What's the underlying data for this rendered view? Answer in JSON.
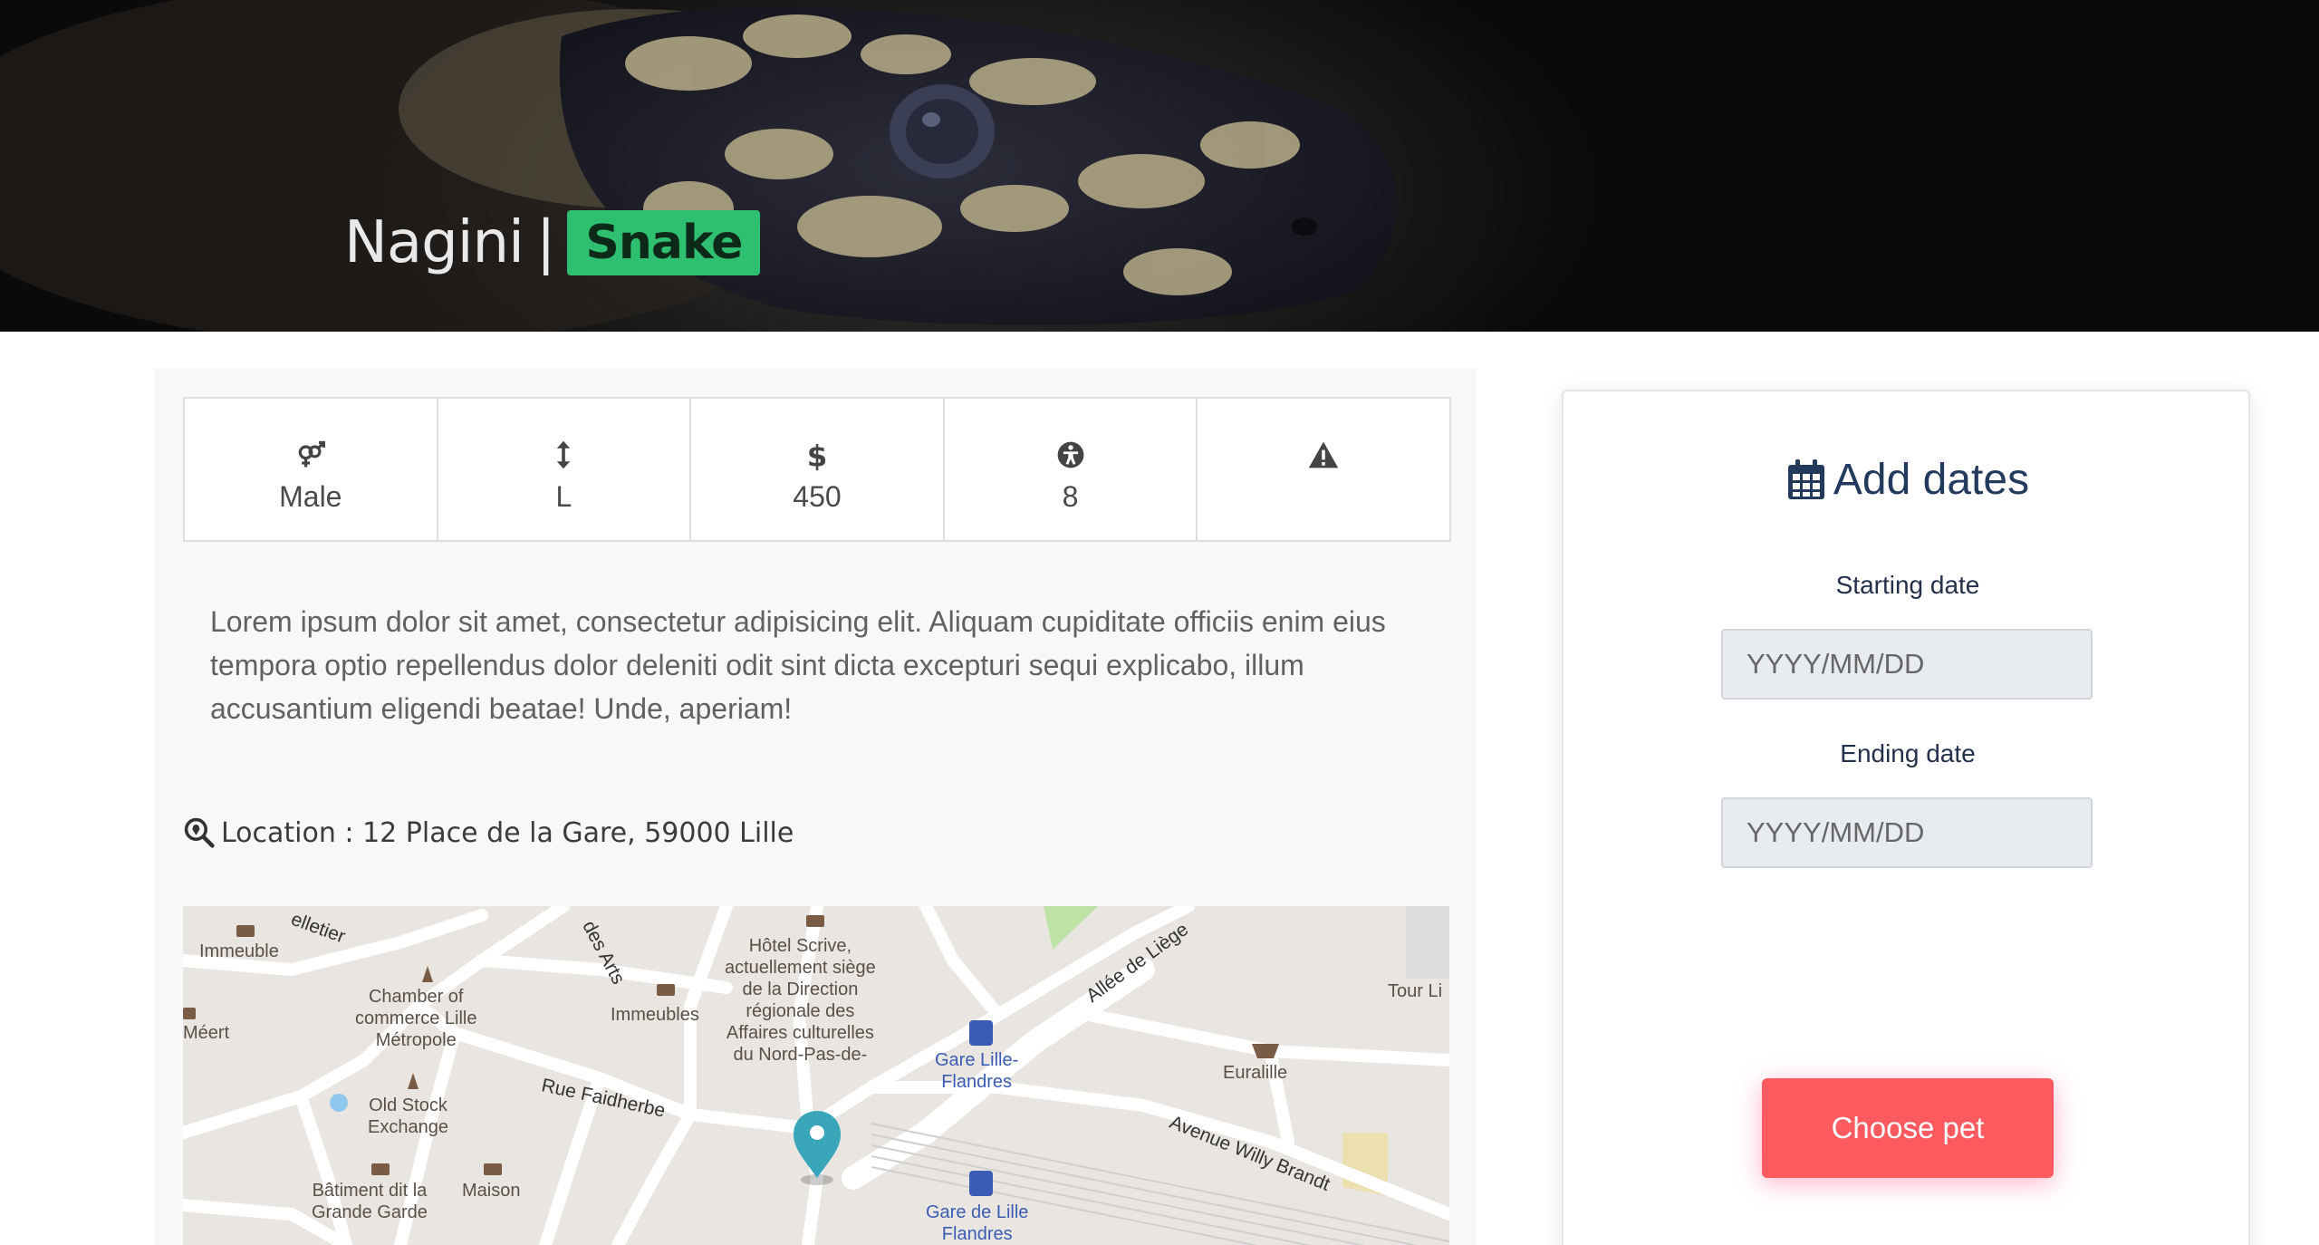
{
  "hero": {
    "pet_name": "Nagini",
    "separator": "|",
    "species": "Snake"
  },
  "stats": [
    {
      "icon": "gender-icon",
      "value": "Male"
    },
    {
      "icon": "size-arrows-icon",
      "value": "L"
    },
    {
      "icon": "dollar-icon",
      "value": "450"
    },
    {
      "icon": "accessibility-icon",
      "value": "8"
    },
    {
      "icon": "warning-icon",
      "value": ""
    }
  ],
  "description": "Lorem ipsum dolor sit amet, consectetur adipisicing elit. Aliquam cupiditate officiis enim eius tempora optio repellendus dolor deleniti odit sint dicta excepturi sequi explicabo, illum accusantium eligendi beatae! Unde, aperiam!",
  "location": {
    "icon": "search-location-icon",
    "text": "Location : 12 Place de la Gare, 59000 Lille"
  },
  "map": {
    "labels": {
      "immeuble": "Immeuble",
      "meert": "Méert",
      "chamber": "Chamber of\ncommerce Lille\nMétropole",
      "old_stock": "Old Stock\nExchange",
      "batiment": "Bâtiment dit la\nGrande Garde",
      "maison": "Maison",
      "immeubles": "Immeubles",
      "hotel_scrive": "Hôtel Scrive,\nactuellement siège\nde la Direction\nrégionale des\nAffaires culturelles\ndu Nord-Pas-de-",
      "gare_flandres_1": "Gare Lille-\nFlandres",
      "gare_flandres_2": "Gare de Lille\nFlandres",
      "euralille": "Euralille",
      "tour_li": "Tour Li"
    },
    "streets": {
      "pelletier": "elletier",
      "des_arts": "des Arts",
      "faidherbe": "Rue Faidherbe",
      "allee_liege": "Allée de Liège",
      "willy_brandt": "Avenue Willy Brandt"
    }
  },
  "booking": {
    "title": "Add dates",
    "start_label": "Starting date",
    "start_placeholder": "YYYY/MM/DD",
    "end_label": "Ending date",
    "end_placeholder": "YYYY/MM/DD",
    "button_label": "Choose pet"
  },
  "colors": {
    "species_badge": "#2fbf71",
    "button": "#ff5a5f",
    "title": "#233a5c",
    "map_pin": "#3aa6b9"
  }
}
